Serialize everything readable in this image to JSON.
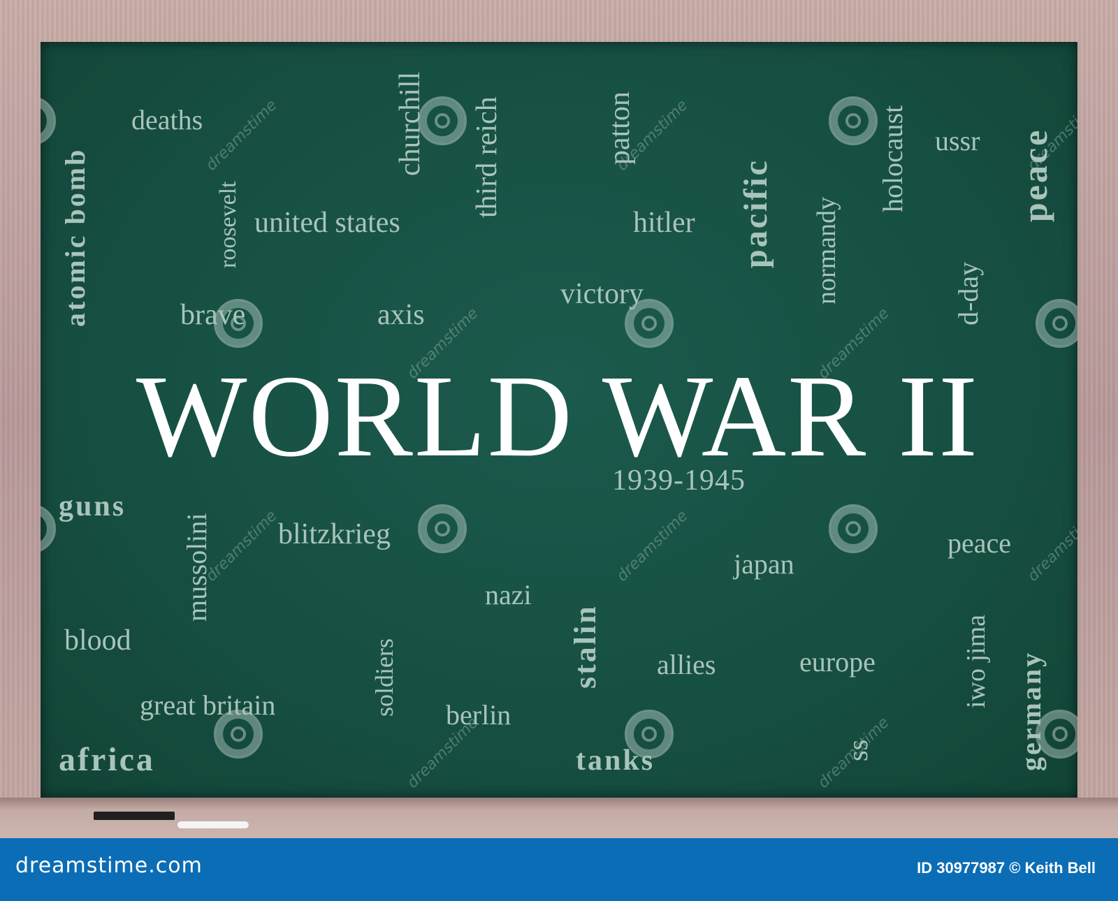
{
  "title": "WORLD WAR II",
  "years": "1939-1945",
  "words": {
    "atomic_bomb": "atomic bomb",
    "deaths": "deaths",
    "roosevelt": "roosevelt",
    "churchill": "churchill",
    "third_reich": "third reich",
    "united_states": "united states",
    "patton": "patton",
    "hitler": "hitler",
    "pacific": "pacific",
    "normandy": "normandy",
    "holocaust": "holocaust",
    "ussr": "ussr",
    "peace": "peace",
    "brave": "brave",
    "axis": "axis",
    "victory": "victory",
    "d_day": "d-day",
    "guns": "guns",
    "mussolini": "mussolini",
    "blitzkrieg": "blitzkrieg",
    "japan": "japan",
    "peace_2": "peace",
    "nazi": "nazi",
    "stalin": "stalin",
    "blood": "blood",
    "soldiers": "soldiers",
    "allies": "allies",
    "europe": "europe",
    "iwo_jima": "iwo jima",
    "germany": "germany",
    "great_britain": "great britain",
    "berlin": "berlin",
    "ss": "ss",
    "africa": "africa",
    "tanks": "tanks"
  },
  "watermark": "dreamstime",
  "footer": {
    "site": "dreamstime.com",
    "credit": "ID 30977987 © Keith Bell"
  },
  "colors": {
    "board": "#164f42",
    "chalk_text": "#a9c4bb",
    "title": "#ffffff",
    "footer_bg": "#0b6db5"
  }
}
